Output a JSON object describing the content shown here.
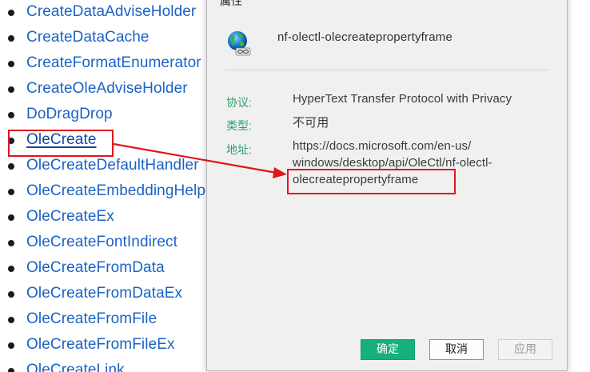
{
  "links": [
    "CreateDataAdviseHolder",
    "CreateDataCache",
    "CreateFormatEnumerator",
    "CreateOleAdviseHolder",
    "DoDragDrop",
    "OleCreate",
    "OleCreateDefaultHandler",
    "OleCreateEmbeddingHelper",
    "OleCreateEx",
    "OleCreateFontIndirect",
    "OleCreateFromData",
    "OleCreateFromDataEx",
    "OleCreateFromFile",
    "OleCreateFromFileEx",
    "OleCreateLink"
  ],
  "active_link_index": 5,
  "dialog": {
    "title": "属性",
    "header_name": "nf-olectl-olecreatepropertyframe",
    "protocol_label": "协议:",
    "protocol_value": "HyperText Transfer Protocol with Privacy",
    "type_label": "类型:",
    "type_value": "不可用",
    "address_label": "地址:",
    "address_line1": "https://docs.microsoft.com/en-us/",
    "address_line2": "windows/desktop/api/OleCtl/nf-olectl-",
    "address_line3": "olecreatepropertyframe",
    "ok_label": "确定",
    "cancel_label": "取消",
    "apply_label": "应用"
  },
  "colors": {
    "link": "#1a63c5",
    "highlight": "#e0151d",
    "label": "#2aa06a",
    "ok_button": "#17b07c"
  }
}
